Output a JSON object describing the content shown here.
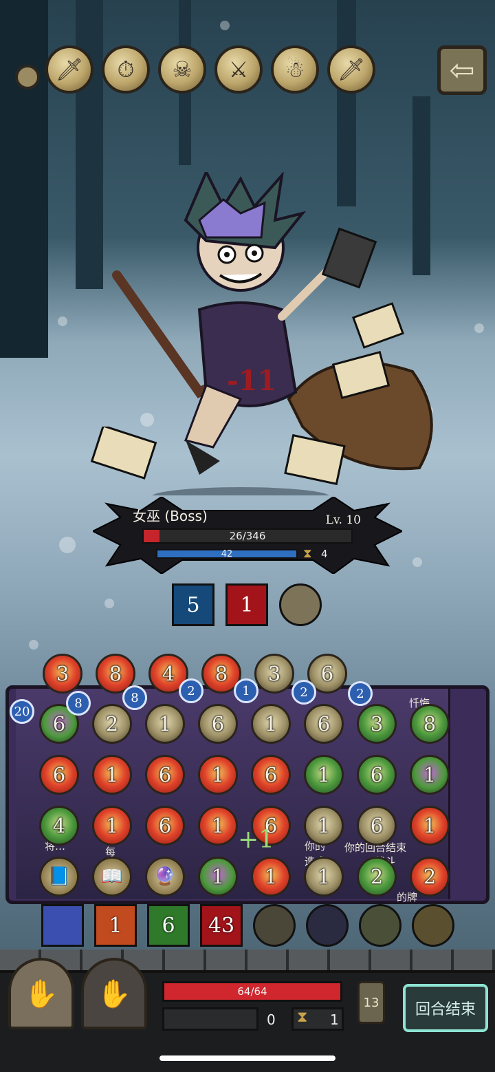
{
  "relics": [
    {
      "icon": "sword-icon",
      "glyph": "🗡"
    },
    {
      "icon": "pocket-watch-icon",
      "glyph": "⏱"
    },
    {
      "icon": "hooded-figure-icon",
      "glyph": "☠"
    },
    {
      "icon": "broken-sword-icon",
      "glyph": "⚔"
    },
    {
      "icon": "witch-icon",
      "glyph": "☃"
    },
    {
      "icon": "sword-icon",
      "glyph": "🗡"
    }
  ],
  "back_button": {
    "glyph": "⇦"
  },
  "damage_float": "-11",
  "boss": {
    "name": "女巫 (Boss)",
    "level": "Lv. 10",
    "hp_text": "26/346",
    "hp_fraction": 0.075,
    "mana_text": "42",
    "mana_fraction": 1.0,
    "turns": "4"
  },
  "boss_status": [
    {
      "icon": "vortex-icon",
      "value": "5",
      "color": "#15497a"
    },
    {
      "icon": "rage-icon",
      "value": "1",
      "color": "#a2141a"
    },
    {
      "icon": "tombstone-icon",
      "value": "",
      "color": "#7d7358"
    }
  ],
  "board": {
    "column_labels": [
      "忏悔",
      "将…",
      "每",
      "你的",
      "你的回合结束",
      "造成",
      "战斗",
      "的牌"
    ],
    "badges": [
      "20",
      "8",
      "8",
      "2",
      "1",
      "2",
      "2"
    ],
    "top_row": [
      "3",
      "8",
      "4",
      "8",
      "3",
      "6"
    ],
    "grid": [
      [
        [
          "6",
          "poison"
        ],
        [
          "2",
          "ghost"
        ],
        [
          "1",
          "ghost"
        ],
        [
          "6",
          "ghost"
        ],
        [
          "1",
          "ghost"
        ],
        [
          "6",
          "ghost"
        ],
        [
          "3",
          "nature"
        ],
        [
          "8",
          "nature"
        ]
      ],
      [
        [
          "6",
          "fire"
        ],
        [
          "1",
          "fire"
        ],
        [
          "6",
          "fire"
        ],
        [
          "1",
          "fire"
        ],
        [
          "6",
          "fire"
        ],
        [
          "1",
          "nature"
        ],
        [
          "6",
          "nature"
        ],
        [
          "1",
          "poison"
        ]
      ],
      [
        [
          "4",
          "nature"
        ],
        [
          "1",
          "fire"
        ],
        [
          "6",
          "fire"
        ],
        [
          "1",
          "fire"
        ],
        [
          "6",
          "fire"
        ],
        [
          "1",
          "ghost"
        ],
        [
          "6",
          "ghost"
        ],
        [
          "1",
          "fire"
        ]
      ],
      [
        [
          "",
          "item"
        ],
        [
          "",
          "item"
        ],
        [
          "",
          "item"
        ],
        [
          "1",
          "poison"
        ],
        [
          "1",
          "fire"
        ],
        [
          "1",
          "ghost"
        ],
        [
          "2",
          "nature"
        ],
        [
          "2",
          "fire"
        ]
      ]
    ],
    "plus_one": "+1"
  },
  "skills": [
    {
      "icon": "lightning-icon",
      "value": "",
      "color": "#3a4fb0"
    },
    {
      "icon": "fire-wall-icon",
      "value": "1",
      "color": "#c24a1f"
    },
    {
      "icon": "heal-icon",
      "value": "6",
      "color": "#2f7a2a"
    },
    {
      "icon": "fire-burst-icon",
      "value": "43",
      "color": "#a2141a"
    },
    {
      "icon": "priest-icon",
      "value": "",
      "color": "#4a4638"
    },
    {
      "icon": "spellbook-icon",
      "value": "",
      "color": "#2a2a40"
    },
    {
      "icon": "zombie-icon",
      "value": "",
      "color": "#4a5038"
    },
    {
      "icon": "yellow-burst-icon",
      "value": "",
      "color": "#5a5030"
    }
  ],
  "player": {
    "hp_text": "64/64",
    "hp_fraction": 1.0,
    "shield": "0",
    "hourglass": "1",
    "deck_count": "13"
  },
  "end_turn_label": "回合结束"
}
